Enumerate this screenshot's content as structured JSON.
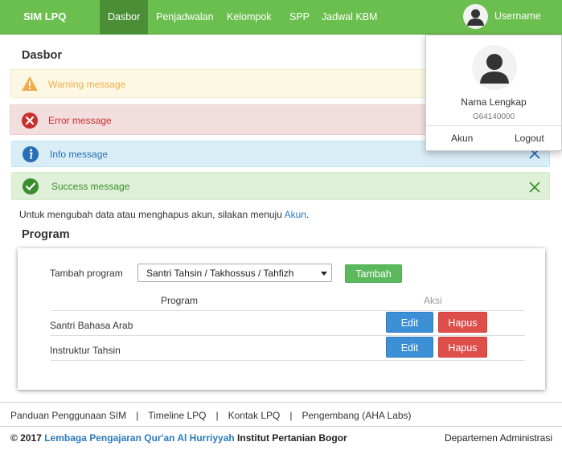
{
  "navbar": {
    "brand": "SIM LPQ",
    "items": [
      {
        "label": "Dasbor"
      },
      {
        "label": "Penjadwalan"
      },
      {
        "label": "Kelompok"
      },
      {
        "label": "SPP"
      },
      {
        "label": "Jadwal KBM"
      }
    ],
    "username": "Username"
  },
  "dropdown": {
    "full_name": "Nama Lengkap",
    "nim": "G64140000",
    "account_link": "Akun",
    "logout_link": "Logout"
  },
  "page_title": "Dasbor",
  "alerts": {
    "warning": "Warning message",
    "error": "Error message",
    "info": "Info message",
    "success": "Success message"
  },
  "note": {
    "text": "Untuk mengubah data atau menghapus akun, silakan menuju",
    "link": "Akun",
    "suffix": "."
  },
  "program": {
    "title": "Program",
    "add_label": "Tambah program",
    "select_value": "Santri Tahsin / Takhossus / Tahfizh",
    "add_button": "Tambah",
    "columns": {
      "program": "Program",
      "action": "Aksi"
    },
    "rows": [
      {
        "name": "Santri Bahasa Arab",
        "edit": "Edit",
        "delete": "Hapus"
      },
      {
        "name": "Instruktur Tahsin",
        "edit": "Edit",
        "delete": "Hapus"
      }
    ]
  },
  "footer": {
    "links": [
      "Panduan Penggunaan SIM",
      "Timeline LPQ",
      "Kontak LPQ",
      "Pengembang (AHA Labs)"
    ],
    "separator": "|",
    "copyright_prefix": "© 2017",
    "org": "Lembaga Pengajaran Qur'an Al Hurriyyah",
    "institution": "Institut Pertanian Bogor",
    "department": "Departemen Administrasi"
  },
  "colors": {
    "navbar": "#6bbf4e",
    "nav_active": "#4a8f36",
    "warning_text": "#f0ad4e",
    "error_text": "#c9302c",
    "info_text": "#2a6fb5",
    "success_text": "#3c8d2f",
    "edit_button": "#3d8fd6",
    "delete_button": "#de4e4b",
    "add_button": "#5cb85c"
  },
  "icons": {
    "user": "user-silhouette-icon",
    "warning": "warning-triangle-icon",
    "error": "error-x-circle-icon",
    "info": "info-circle-icon",
    "success": "check-circle-icon",
    "close": "close-x-icon"
  }
}
